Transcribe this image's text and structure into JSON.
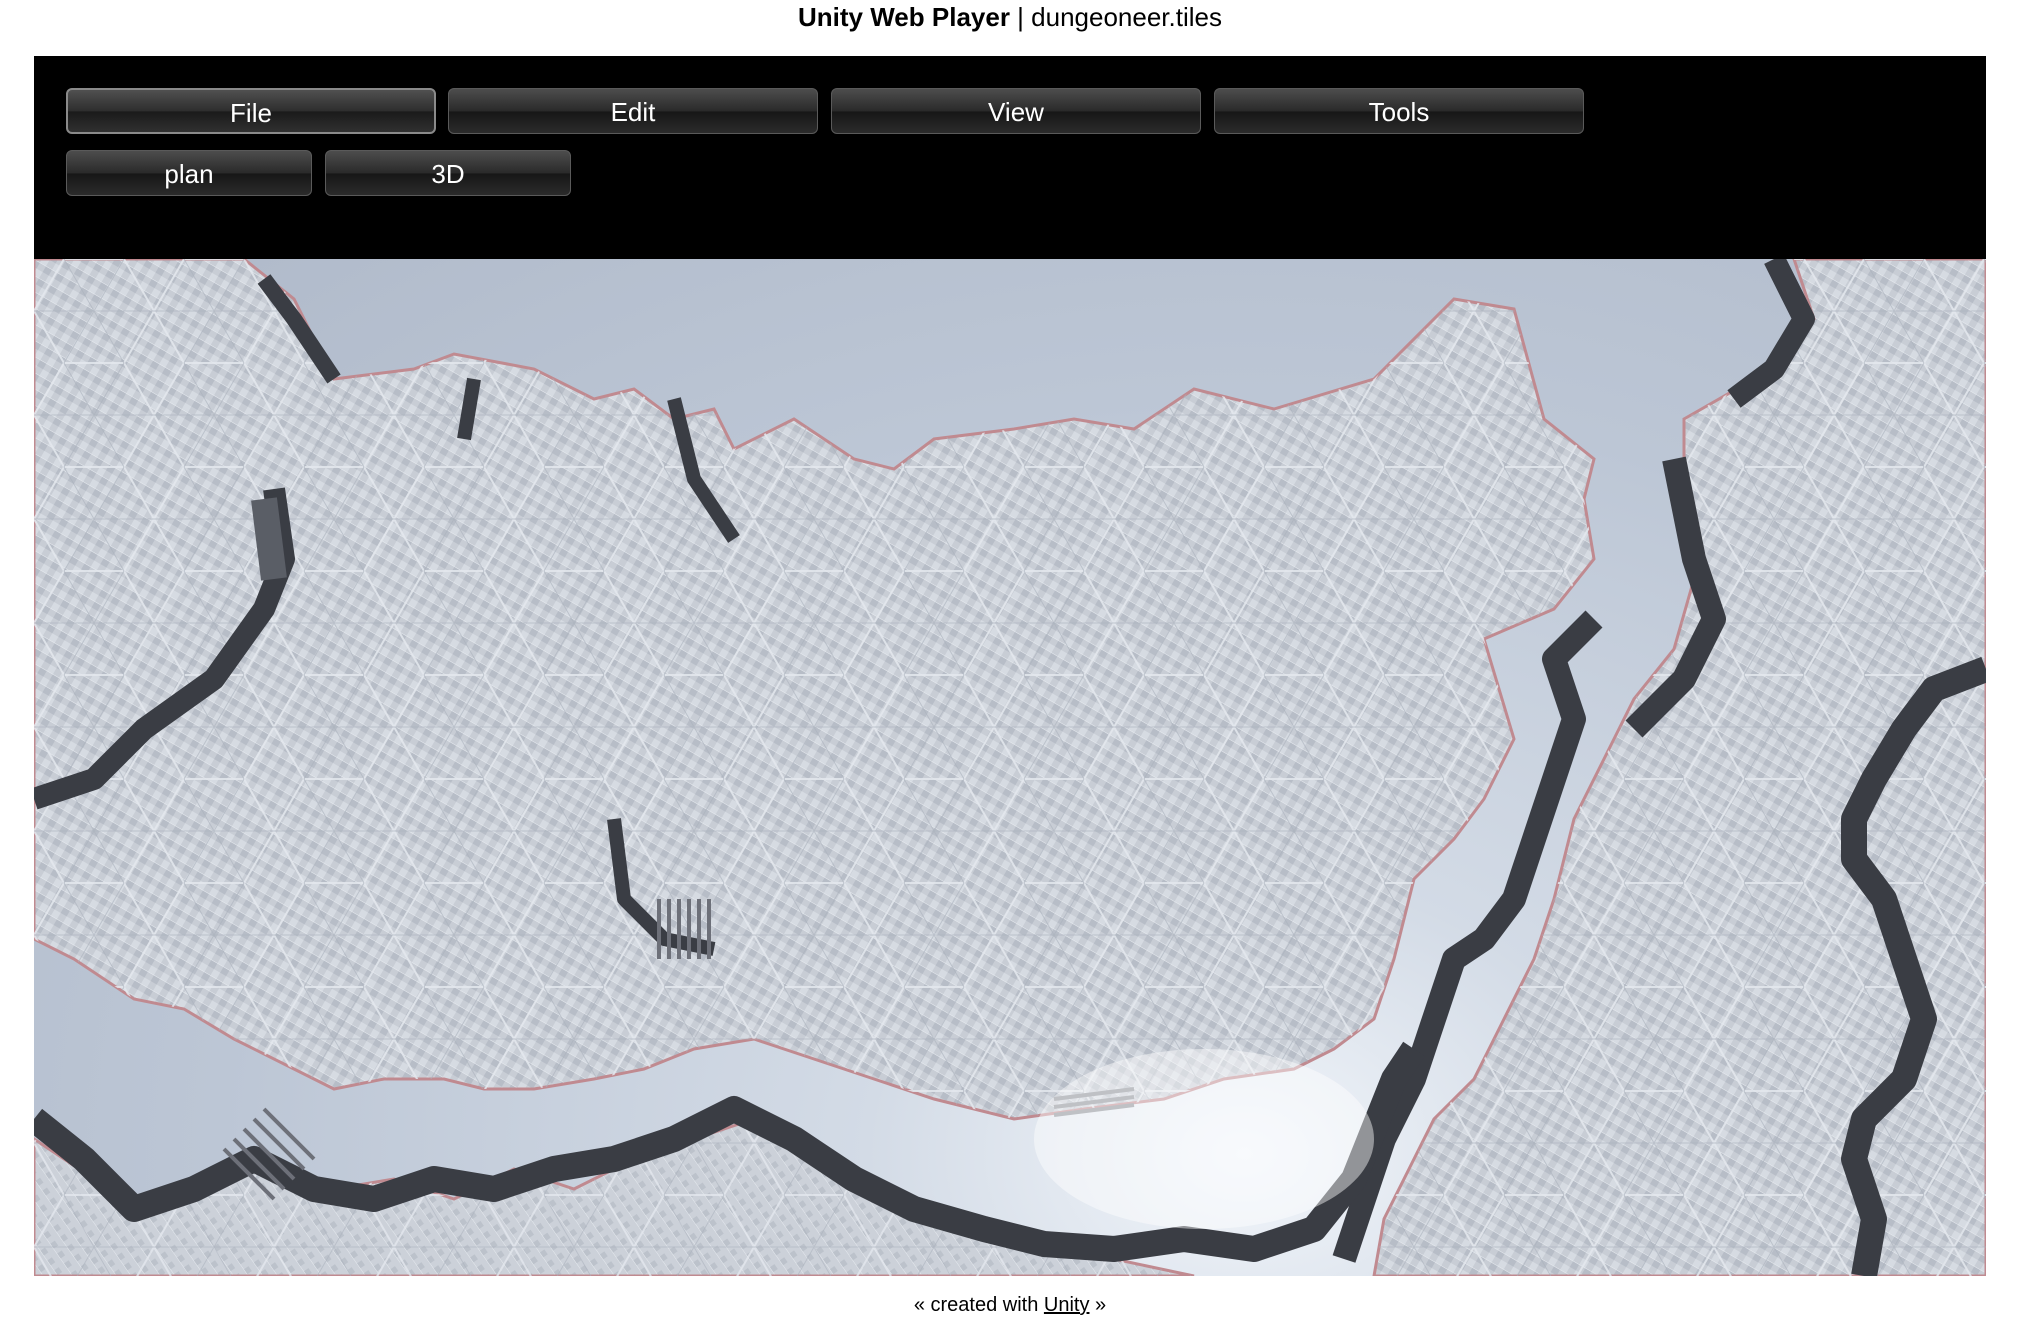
{
  "page": {
    "title_bold": "Unity Web Player",
    "title_separator": " | ",
    "title_rest": "dungeoneer.tiles"
  },
  "menu": {
    "file_label": "File",
    "edit_label": "Edit",
    "view_label": "View",
    "tools_label": "Tools",
    "active": "File"
  },
  "view_modes": {
    "plan_label": "plan",
    "threed_label": "3D"
  },
  "scene": {
    "description_icon": "hex-tile-dungeon-scene",
    "floor_color": "#c9ced6",
    "wall_color": "#3a3d44",
    "edge_color": "#c98f93",
    "sky_color": "#bcc6d5"
  },
  "footer": {
    "prefix": "« created with ",
    "link_label": "Unity",
    "suffix": " »"
  }
}
